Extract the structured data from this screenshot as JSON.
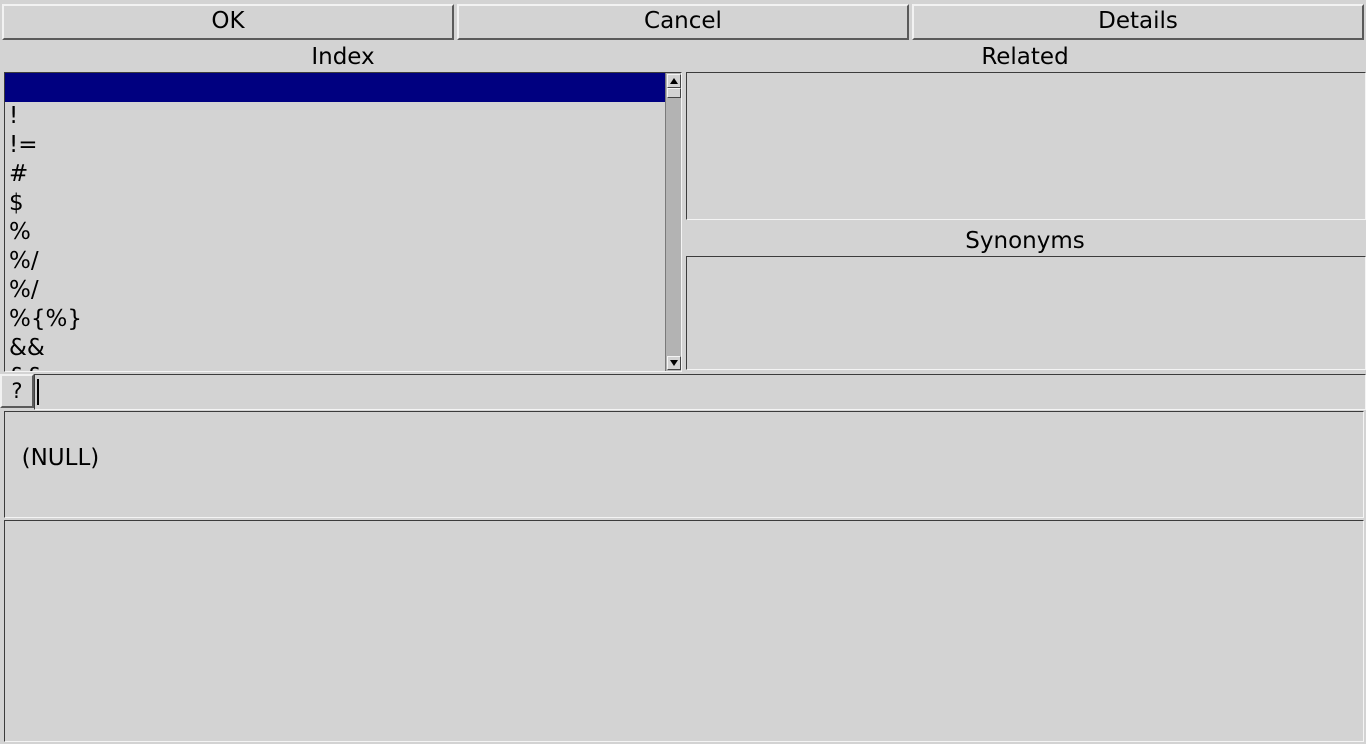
{
  "buttons": {
    "ok": "OK",
    "cancel": "Cancel",
    "details": "Details"
  },
  "labels": {
    "index": "Index",
    "related": "Related",
    "synonyms": "Synonyms"
  },
  "index_list": {
    "items": [
      "",
      "!",
      "!=",
      "#",
      "$",
      "%",
      "%/",
      "%/",
      "%{%}",
      "&&",
      "&&"
    ],
    "selected_index": 0
  },
  "related_list": {
    "items": []
  },
  "synonyms_list": {
    "items": []
  },
  "search": {
    "button_label": "?",
    "value": ""
  },
  "description": {
    "text": "(NULL)"
  },
  "details_area": {
    "text": ""
  },
  "colors": {
    "background": "#d3d3d3",
    "selection": "#000080",
    "selection_text": "#ffffff"
  },
  "icons": {
    "scroll_up": "triangle-up-icon",
    "scroll_down": "triangle-down-icon"
  }
}
